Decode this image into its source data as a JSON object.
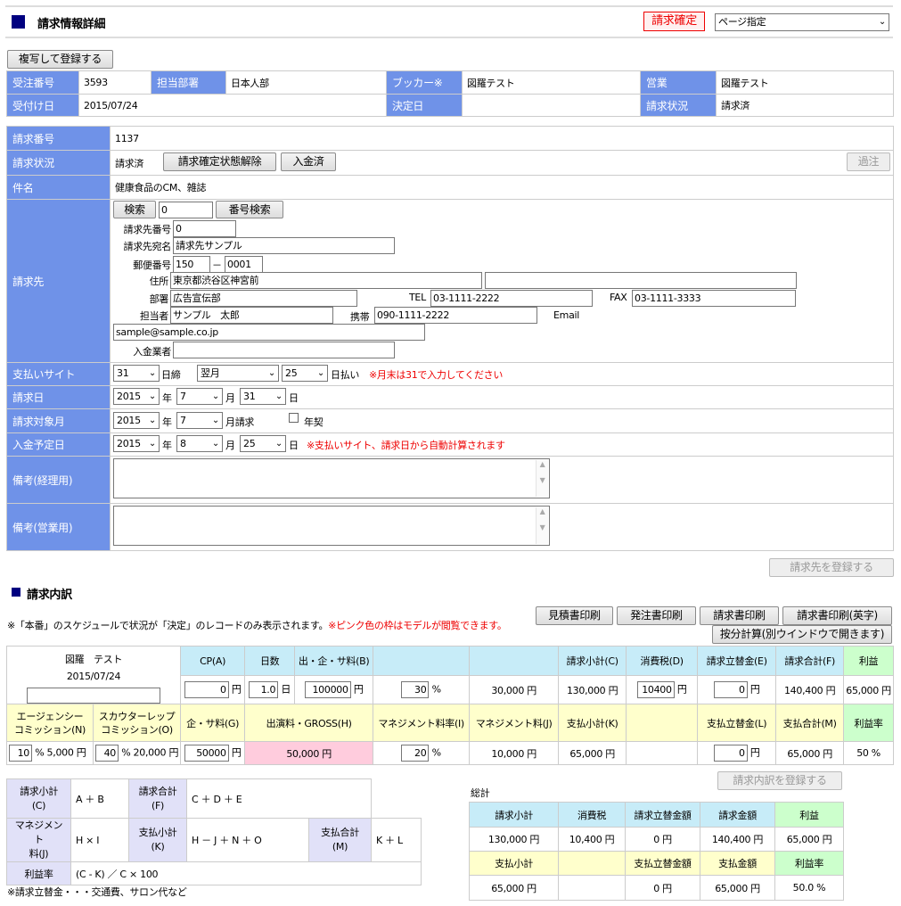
{
  "header": {
    "title": "請求情報詳細",
    "status_badge": "請求確定",
    "page_select": "ページ指定",
    "copy_button": "複写して登録する"
  },
  "top": {
    "labels": [
      "受注番号",
      "担当部署",
      "ブッカー※",
      "営業",
      "受付け日",
      "決定日",
      "請求状況"
    ],
    "order_no": "3593",
    "dept": "日本人部",
    "booker": "図羅テスト",
    "sales": "図羅テスト",
    "received_date": "2015/07/24",
    "decided_date": "",
    "billing_status": "請求済"
  },
  "detail": {
    "invoice_no_label": "請求番号",
    "invoice_no": "1137",
    "status_label": "請求状況",
    "status": "請求済",
    "unconfirm_button": "請求確定状態解除",
    "paid_button": "入金済",
    "overdue_button": "過注",
    "subject_label": "件名",
    "subject": "健康食品のCM、雑誌",
    "client_label": "請求先",
    "search_button": "検索",
    "search_value": "0",
    "number_search_button": "番号検索",
    "client_no_label": "請求先番号",
    "client_no": "0",
    "client_name_label": "請求先宛名",
    "client_name": "請求先サンプル",
    "zip_label": "郵便番号",
    "zip1": "150",
    "zip_sep": "－",
    "zip2": "0001",
    "address_label": "住所",
    "address": "東京都渋谷区神宮前",
    "address2": "",
    "dept_label": "部署",
    "dept": "広告宣伝部",
    "tel_label": "TEL",
    "tel": "03-1111-2222",
    "fax_label": "FAX",
    "fax": "03-1111-3333",
    "person_label": "担当者",
    "person": "サンプル　太郎",
    "mobile_label": "携帯",
    "mobile": "090-1111-2222",
    "email_label": "Email",
    "email": "sample@sample.co.jp",
    "payer_label": "入金業者",
    "payer": "",
    "site_label": "支払いサイト",
    "site_close": "31",
    "site_close_unit": "日締",
    "site_month": "翌月",
    "site_day": "25",
    "site_day_unit": "日払い",
    "site_note": "※月末は31で入力してください",
    "invoice_date_label": "請求日",
    "inv_year": "2015",
    "inv_month": "7",
    "inv_day": "31",
    "target_label": "請求対象月",
    "tgt_year": "2015",
    "tgt_month": "7",
    "tgt_month_unit": "月請求",
    "annual_label": "年契",
    "due_label": "入金予定日",
    "due_year": "2015",
    "due_month": "8",
    "due_day": "25",
    "due_note": "※支払いサイト、請求日から自動計算されます",
    "year_unit": "年",
    "month_unit": "月",
    "day_unit": "日",
    "memo_acct_label": "備考(経理用)",
    "memo_sales_label": "備考(営業用)",
    "register_client_button": "請求先を登録する"
  },
  "breakdown": {
    "title": "請求内訳",
    "note": "※「本番」のスケジュールで状況が「決定」のレコードのみ表示されます。",
    "note_red": "※ピンク色の枠はモデルが閲覧できます。",
    "buttons": [
      "見積書印刷",
      "発注書印刷",
      "請求書印刷",
      "請求書印刷(英字)"
    ],
    "prorate_button": "按分計算(別ウインドウで開きます)",
    "model_name": "図羅　テスト",
    "model_date": "2015/07/24",
    "h1": [
      "CP(A)",
      "日数",
      "出・企・サ料(B)",
      "",
      "",
      "請求小計(C)",
      "消費税(D)",
      "請求立替金(E)",
      "請求合計(F)",
      "利益"
    ],
    "cp": "0",
    "cp_unit": "円",
    "days": "1.0",
    "days_unit": "日",
    "fee_b": "100000",
    "fee_b_unit": "円",
    "pct1": "30",
    "pct_unit": "%",
    "v1": "30,000 円",
    "subtotal_c": "130,000 円",
    "tax_d": "10400",
    "tax_unit": "円",
    "advance_e": "0",
    "advance_unit": "円",
    "total_f": "140,400 円",
    "profit": "65,000 円",
    "h2": [
      "エージェンシー\nコミッション(N)",
      "スカウターレップ\nコミッション(O)",
      "企・サ料(G)",
      "出演料・GROSS(H)",
      "マネジメント料率(I)",
      "マネジメント料(J)",
      "支払小計(K)",
      "",
      "支払立替金(L)",
      "支払合計(M)",
      "利益率"
    ],
    "agency_pct": "10",
    "agency_amt": "% 5,000 円",
    "scout_pct": "40",
    "scout_amt": "% 20,000 円",
    "fee_g": "50000",
    "fee_g_unit": "円",
    "gross_h": "50,000 円",
    "mgmt_pct": "20",
    "mgmt_unit": "%",
    "mgmt_j": "10,000 円",
    "pay_sub_k": "65,000 円",
    "pay_adv_l": "0",
    "pay_adv_unit": "円",
    "pay_total_m": "65,000 円",
    "profit_rate": "50 %",
    "register_button": "請求内訳を登録する"
  },
  "formula": {
    "r1": [
      "請求小計\n(C)",
      "A ＋ B",
      "請求合計\n(F)",
      "C ＋ D ＋ E"
    ],
    "r2": [
      "マネジメント\n料(J)",
      "H × I",
      "支払小計\n(K)",
      "H － J ＋ N ＋ O",
      "支払合計\n(M)",
      "K ＋ L"
    ],
    "r3": [
      "利益率",
      "(C - K) ／ C × 100"
    ],
    "footnote": "※請求立替金・・・交通費、サロン代など"
  },
  "totals": {
    "title": "総計",
    "h1": [
      "請求小計",
      "消費税",
      "請求立替金額",
      "請求金額",
      "利益"
    ],
    "v1": [
      "130,000 円",
      "10,400 円",
      "0 円",
      "140,400 円",
      "65,000 円"
    ],
    "h2": [
      "支払小計",
      "",
      "支払立替金額",
      "支払金額",
      "利益率"
    ],
    "v2": [
      "65,000 円",
      "",
      "0 円",
      "65,000 円",
      "50.0 %"
    ]
  }
}
